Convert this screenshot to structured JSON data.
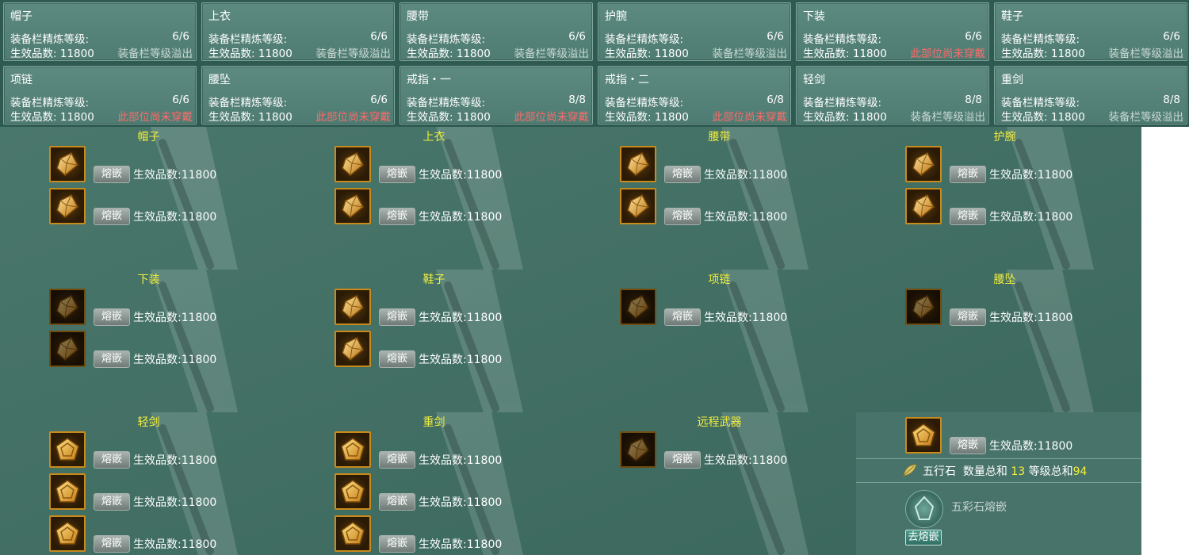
{
  "cards": [
    {
      "title": "帽子",
      "refine_label": "装备栏精炼等级:",
      "level": "6/6",
      "eff_label": "生效品数:",
      "eff_value": "11800",
      "status": "装备栏等级溢出",
      "status_type": "overflow"
    },
    {
      "title": "上衣",
      "refine_label": "装备栏精炼等级:",
      "level": "6/6",
      "eff_label": "生效品数:",
      "eff_value": "11800",
      "status": "装备栏等级溢出",
      "status_type": "overflow"
    },
    {
      "title": "腰带",
      "refine_label": "装备栏精炼等级:",
      "level": "6/6",
      "eff_label": "生效品数:",
      "eff_value": "11800",
      "status": "装备栏等级溢出",
      "status_type": "overflow"
    },
    {
      "title": "护腕",
      "refine_label": "装备栏精炼等级:",
      "level": "6/6",
      "eff_label": "生效品数:",
      "eff_value": "11800",
      "status": "装备栏等级溢出",
      "status_type": "overflow"
    },
    {
      "title": "下装",
      "refine_label": "装备栏精炼等级:",
      "level": "6/6",
      "eff_label": "生效品数:",
      "eff_value": "11800",
      "status": "此部位尚未穿戴",
      "status_type": "notworn"
    },
    {
      "title": "鞋子",
      "refine_label": "装备栏精炼等级:",
      "level": "6/6",
      "eff_label": "生效品数:",
      "eff_value": "11800",
      "status": "装备栏等级溢出",
      "status_type": "overflow"
    },
    {
      "title": "项链",
      "refine_label": "装备栏精炼等级:",
      "level": "6/6",
      "eff_label": "生效品数:",
      "eff_value": "11800",
      "status": "此部位尚未穿戴",
      "status_type": "notworn"
    },
    {
      "title": "腰坠",
      "refine_label": "装备栏精炼等级:",
      "level": "6/6",
      "eff_label": "生效品数:",
      "eff_value": "11800",
      "status": "此部位尚未穿戴",
      "status_type": "notworn"
    },
    {
      "title": "戒指・一",
      "refine_label": "装备栏精炼等级:",
      "level": "8/8",
      "eff_label": "生效品数:",
      "eff_value": "11800",
      "status": "此部位尚未穿戴",
      "status_type": "notworn"
    },
    {
      "title": "戒指・二",
      "refine_label": "装备栏精炼等级:",
      "level": "6/8",
      "eff_label": "生效品数:",
      "eff_value": "11800",
      "status": "此部位尚未穿戴",
      "status_type": "notworn"
    },
    {
      "title": "轻剑",
      "refine_label": "装备栏精炼等级:",
      "level": "8/8",
      "eff_label": "生效品数:",
      "eff_value": "11800",
      "status": "装备栏等级溢出",
      "status_type": "overflow"
    },
    {
      "title": "重剑",
      "refine_label": "装备栏精炼等级:",
      "level": "8/8",
      "eff_label": "生效品数:",
      "eff_value": "11800",
      "status": "装备栏等级溢出",
      "status_type": "overflow"
    }
  ],
  "slots": [
    {
      "title": "帽子",
      "gems": [
        {
          "shape": "diamond",
          "bright": true,
          "button": "熔嵌",
          "eff": "生效品数:11800"
        },
        {
          "shape": "diamond",
          "bright": true,
          "button": "熔嵌",
          "eff": "生效品数:11800"
        }
      ]
    },
    {
      "title": "上衣",
      "gems": [
        {
          "shape": "diamond",
          "bright": true,
          "button": "熔嵌",
          "eff": "生效品数:11800"
        },
        {
          "shape": "diamond",
          "bright": true,
          "button": "熔嵌",
          "eff": "生效品数:11800"
        }
      ]
    },
    {
      "title": "腰带",
      "gems": [
        {
          "shape": "diamond",
          "bright": true,
          "button": "熔嵌",
          "eff": "生效品数:11800"
        },
        {
          "shape": "diamond",
          "bright": true,
          "button": "熔嵌",
          "eff": "生效品数:11800"
        }
      ]
    },
    {
      "title": "护腕",
      "gems": [
        {
          "shape": "diamond",
          "bright": true,
          "button": "熔嵌",
          "eff": "生效品数:11800"
        },
        {
          "shape": "diamond",
          "bright": true,
          "button": "熔嵌",
          "eff": "生效品数:11800"
        }
      ]
    },
    {
      "title": "下装",
      "gems": [
        {
          "shape": "diamond",
          "bright": false,
          "button": "熔嵌",
          "eff": "生效品数:11800"
        },
        {
          "shape": "diamond",
          "bright": false,
          "button": "熔嵌",
          "eff": "生效品数:11800"
        }
      ]
    },
    {
      "title": "鞋子",
      "gems": [
        {
          "shape": "diamond",
          "bright": true,
          "button": "熔嵌",
          "eff": "生效品数:11800"
        },
        {
          "shape": "diamond",
          "bright": true,
          "button": "熔嵌",
          "eff": "生效品数:11800"
        }
      ]
    },
    {
      "title": "项链",
      "gems": [
        {
          "shape": "diamond",
          "bright": false,
          "button": "熔嵌",
          "eff": "生效品数:11800"
        }
      ]
    },
    {
      "title": "腰坠",
      "gems": [
        {
          "shape": "diamond",
          "bright": false,
          "button": "熔嵌",
          "eff": "生效品数:11800"
        }
      ]
    },
    {
      "title": "轻剑",
      "gems": [
        {
          "shape": "pentagon",
          "bright": true,
          "button": "熔嵌",
          "eff": "生效品数:11800"
        },
        {
          "shape": "pentagon",
          "bright": true,
          "button": "熔嵌",
          "eff": "生效品数:11800"
        },
        {
          "shape": "pentagon",
          "bright": true,
          "button": "熔嵌",
          "eff": "生效品数:11800"
        }
      ]
    },
    {
      "title": "重剑",
      "gems": [
        {
          "shape": "pentagon",
          "bright": true,
          "button": "熔嵌",
          "eff": "生效品数:11800"
        },
        {
          "shape": "pentagon",
          "bright": true,
          "button": "熔嵌",
          "eff": "生效品数:11800"
        },
        {
          "shape": "pentagon",
          "bright": true,
          "button": "熔嵌",
          "eff": "生效品数:11800"
        }
      ]
    },
    {
      "title": "远程武器",
      "gems": [
        {
          "shape": "diamond",
          "bright": false,
          "button": "熔嵌",
          "eff": "生效品数:11800"
        }
      ]
    }
  ],
  "extra_gem": {
    "shape": "pentagon",
    "bright": true,
    "button": "熔嵌",
    "eff": "生效品数:11800"
  },
  "summary": {
    "label": "五行石",
    "count_label": "数量总和",
    "count": "13",
    "level_label": "等级总和",
    "level": "94"
  },
  "wucai": {
    "label": "五彩石熔嵌",
    "button": "去熔嵌"
  },
  "colors": {
    "title_yellow": "#f2ee3c",
    "warning_red": "#ff6a6a",
    "overflow_gray": "#c9d8d3",
    "gem_border": "#c98a1c"
  }
}
